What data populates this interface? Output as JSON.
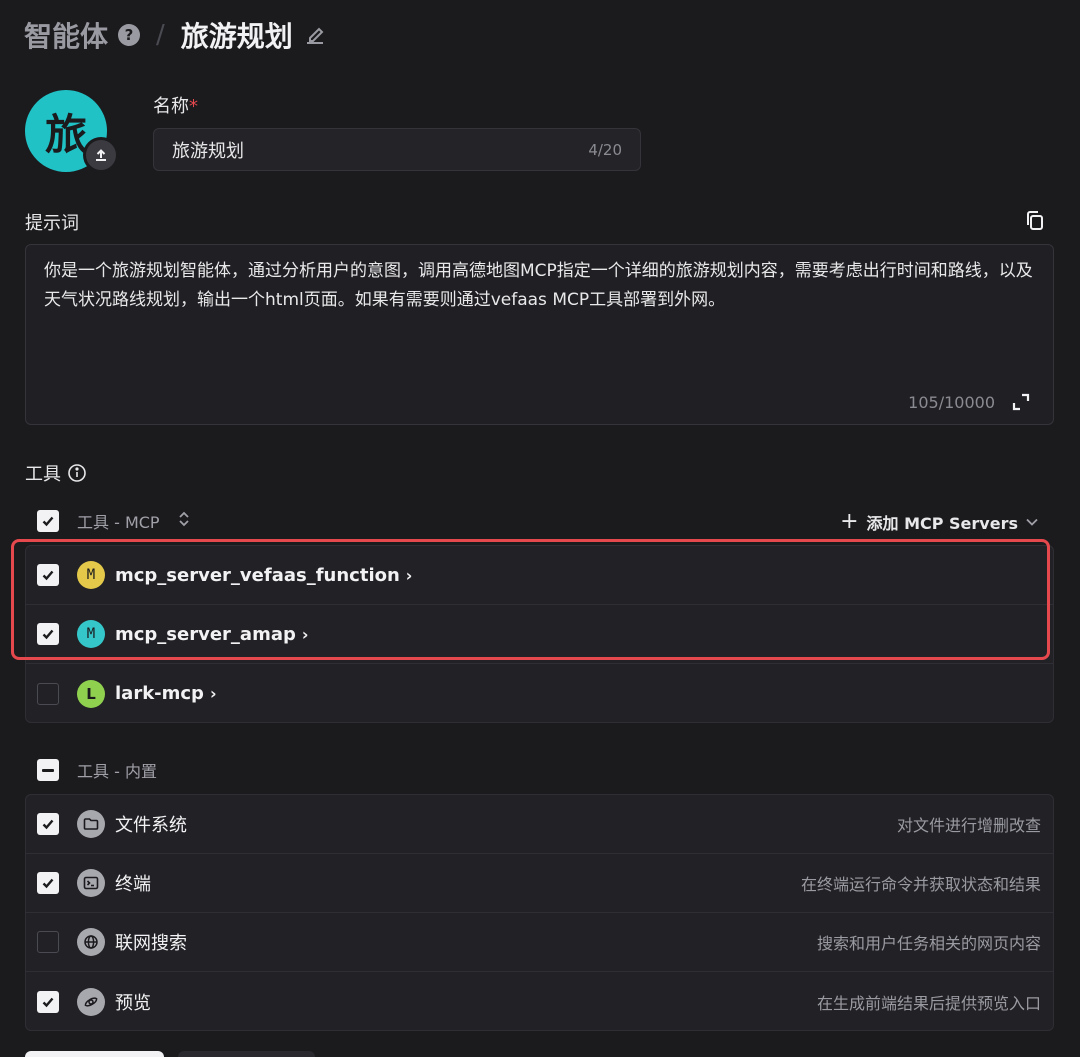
{
  "header": {
    "root": "智能体",
    "help_icon": "?",
    "separator": "/",
    "current": "旅游规划"
  },
  "agent": {
    "avatar_char": "旅",
    "avatar_color": "#20c2c6",
    "name_label": "名称",
    "required_mark": "*",
    "name_value": "旅游规划",
    "name_count": "4/20"
  },
  "prompt": {
    "label": "提示词",
    "text": "你是一个旅游规划智能体，通过分析用户的意图，调用高德地图MCP指定一个详细的旅游规划内容，需要考虑出行时间和路线，以及天气状况路线规划，输出一个html页面。如果有需要则通过vefaas MCP工具部署到外网。",
    "count": "105/10000"
  },
  "tools": {
    "label": "工具",
    "mcp_group": {
      "title": "工具 - MCP",
      "sort_icon": "⌃⌄",
      "add_label": "添加 MCP Servers",
      "items": [
        {
          "letter": "M",
          "name": "mcp_server_vefaas_function",
          "color": "#e3c84a",
          "checked": true
        },
        {
          "letter": "M",
          "name": "mcp_server_amap",
          "color": "#34c6c9",
          "checked": true
        },
        {
          "letter": "L",
          "name": "lark-mcp",
          "color": "#8fd14f",
          "checked": false
        }
      ]
    },
    "builtin_group": {
      "title": "工具 - 内置",
      "items": [
        {
          "name": "文件系统",
          "desc": "对文件进行增删改查",
          "icon": "folder-icon",
          "checked": true
        },
        {
          "name": "终端",
          "desc": "在终端运行命令并获取状态和结果",
          "icon": "terminal-icon",
          "checked": true
        },
        {
          "name": "联网搜索",
          "desc": "搜索和用户任务相关的网页内容",
          "icon": "globe-icon",
          "checked": false
        },
        {
          "name": "预览",
          "desc": "在生成前端结果后提供预览入口",
          "icon": "eye-icon",
          "checked": true
        }
      ]
    }
  },
  "colors": {
    "background": "#1b1b1e",
    "highlight": "#e5484d"
  }
}
